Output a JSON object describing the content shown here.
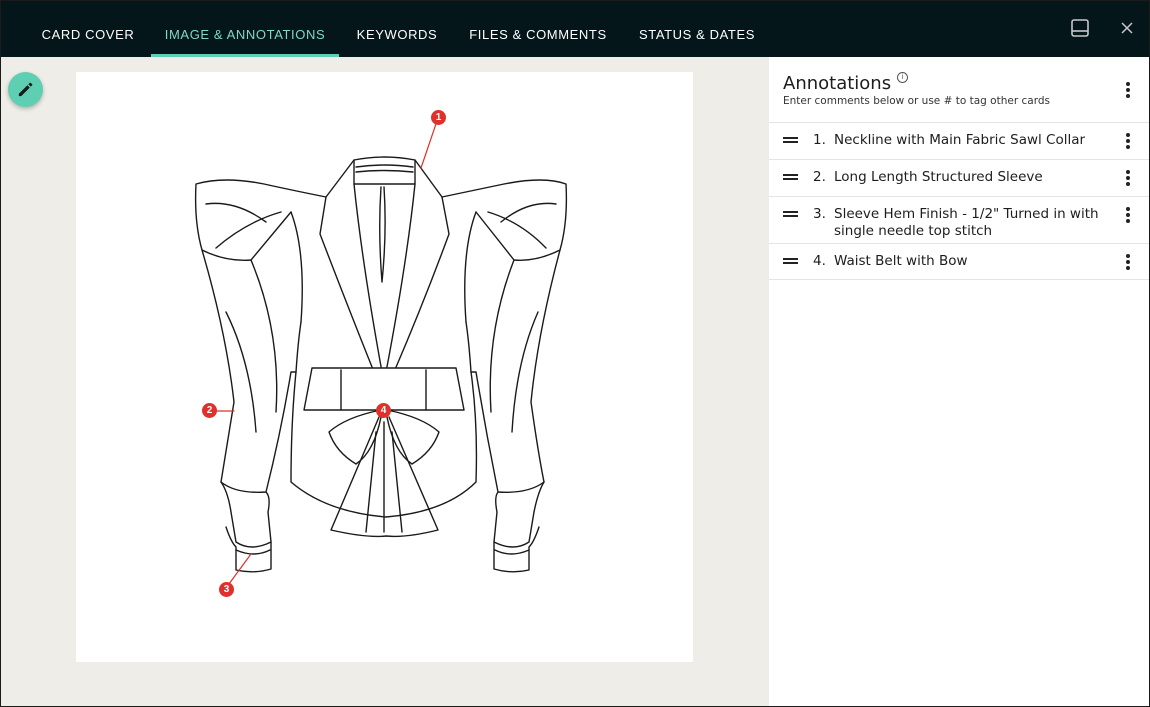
{
  "tabs": [
    {
      "label": "CARD COVER",
      "active": false
    },
    {
      "label": "IMAGE & ANNOTATIONS",
      "active": true
    },
    {
      "label": "KEYWORDS",
      "active": false
    },
    {
      "label": "FILES & COMMENTS",
      "active": false
    },
    {
      "label": "STATUS & DATES",
      "active": false
    }
  ],
  "colors": {
    "accent": "#5fcfb3",
    "topbar": "#04161a",
    "marker": "#e1302b",
    "canvas_bg": "#efede7"
  },
  "panel": {
    "title": "Annotations",
    "subtitle": "Enter comments below or use # to tag other cards",
    "annotations": [
      {
        "num": "1.",
        "text": "Neckline with Main Fabric Sawl Collar"
      },
      {
        "num": "2.",
        "text": "Long Length Structured Sleeve"
      },
      {
        "num": "3.",
        "text": "Sleeve Hem Finish - 1/2\" Turned in with single needle top stitch"
      },
      {
        "num": "4.",
        "text": "Waist Belt with Bow"
      }
    ]
  },
  "markers": [
    {
      "label": "1"
    },
    {
      "label": "2"
    },
    {
      "label": "3"
    },
    {
      "label": "4"
    }
  ],
  "icons": {
    "edit": "pencil-icon",
    "layout": "panel-layout-icon",
    "close": "close-icon",
    "info": "info-icon",
    "menu": "kebab-menu-icon",
    "drag": "drag-handle-icon"
  }
}
